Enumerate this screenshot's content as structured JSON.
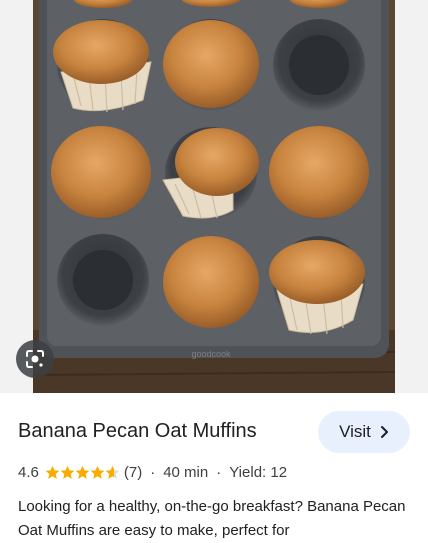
{
  "result": {
    "title": "Banana Pecan Oat Muffins",
    "visit_label": "Visit",
    "rating_value": "4.6",
    "rating_stars": 4.6,
    "review_count": "(7)",
    "separator": "·",
    "time": "40 min",
    "yield": "Yield: 12",
    "description": "Looking for a healthy, on-the-go breakfast? Banana Pecan Oat Muffins are easy to make, perfect for"
  },
  "image": {
    "brand_mark": "goodcook"
  },
  "icons": {
    "lens": "google-lens-icon",
    "chevron": "chevron-right-icon",
    "star": "star-icon"
  },
  "colors": {
    "star": "#f9ab00",
    "visit_bg": "#e8f0fe",
    "text": "#202124"
  }
}
